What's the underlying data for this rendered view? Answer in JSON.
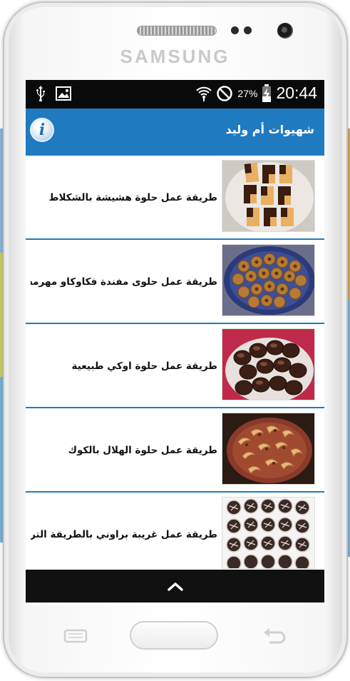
{
  "device": {
    "brand": "SAMSUNG"
  },
  "status_bar": {
    "battery_percent": "27%",
    "time": "20:44",
    "icons": [
      "usb-icon",
      "image-icon",
      "wifi-icon",
      "no-sim-icon",
      "battery-charging-icon"
    ]
  },
  "app_bar": {
    "title": "شهيوات أم وليد",
    "info_icon": "i"
  },
  "recipes": [
    {
      "title": "طريقة عمل حلوة هشيشة بالشكلاط",
      "thumb": "chocolate-checker-cookies"
    },
    {
      "title": "طريقة عمل حلوى مفندة فكاوكاو مهرمش",
      "thumb": "peanut-ring-cookies"
    },
    {
      "title": "طريقة عمل حلوة اوكي طبيعية",
      "thumb": "chocolate-covered-cakes"
    },
    {
      "title": "طريقة عمل حلوة الهلال بالكوك",
      "thumb": "crescent-coconut-cookies"
    },
    {
      "title": "طريقة عمل غريبة براوني بالطريقة التركية",
      "thumb": "brownie-cookies"
    }
  ],
  "nav": {
    "up_icon": "chevron-up-icon"
  },
  "colors": {
    "accent": "#1f7ac0",
    "status_bar": "#0a0a0a",
    "nav_bar": "#111111"
  }
}
